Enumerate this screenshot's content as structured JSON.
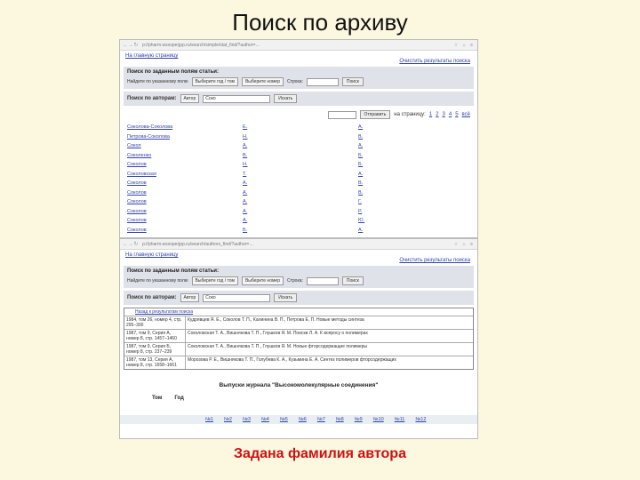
{
  "slide": {
    "title": "Поиск по архиву",
    "caption": "Задана фамилия автора"
  },
  "browser": {
    "url1": "p://pharm.wsxoperjpp.ru/search/simple/stat_find/?author=…",
    "url2": "p://pharm.wsxoperjpp.ru/search/authors_find/?author=…"
  },
  "shot1": {
    "top_link": "На главную страницу",
    "clear_link": "Очистить результаты поиска",
    "search_box": {
      "header": "Поиск по заданным полям статьи:",
      "field_label": "Найдите по указанному полю",
      "select1": "Выберите год / том",
      "select2": "Выберите номер",
      "phrase_label": "Строка:",
      "button": "Поиск"
    },
    "author_box": {
      "label": "Поиск по авторам:",
      "select": "Автор",
      "value": "Соко",
      "button": "Искать"
    },
    "pager": {
      "button": "Отправить",
      "label": "на страницу:",
      "pages": [
        "1",
        "2",
        "3",
        "4",
        "5",
        "всё"
      ]
    },
    "authors": [
      {
        "surname": "Соколова-Соколова",
        "i1": "Е.",
        "i2": "А."
      },
      {
        "surname": "Петрова-Соколова",
        "i1": "Н.",
        "i2": "В."
      },
      {
        "surname": "Сокол",
        "i1": "А.",
        "i2": "А."
      },
      {
        "surname": "Соколенко",
        "i1": "В.",
        "i2": "Б."
      },
      {
        "surname": "Соколов",
        "i1": "Н.",
        "i2": "Б."
      },
      {
        "surname": "Соколовская",
        "i1": "Т.",
        "i2": "А."
      },
      {
        "surname": "Соколов",
        "i1": "А.",
        "i2": "В."
      },
      {
        "surname": "Соколов",
        "i1": "А.",
        "i2": "В."
      },
      {
        "surname": "Соколов",
        "i1": "А.",
        "i2": "Г."
      },
      {
        "surname": "Соколов",
        "i1": "А.",
        "i2": "Р."
      },
      {
        "surname": "Соколов",
        "i1": "А.",
        "i2": "Ю."
      },
      {
        "surname": "Соколов",
        "i1": "Б.",
        "i2": "А."
      }
    ]
  },
  "shot2": {
    "top_link": "На главную страницу",
    "clear_link": "Очистить результаты поиска",
    "search_box": {
      "header": "Поиск по заданным полям статьи:",
      "field_label": "Найдите по указанному полю",
      "select1": "Выберите год / том",
      "select2": "Выберите номер",
      "phrase_label": "Строка:",
      "button": "Поиск"
    },
    "author_box": {
      "label": "Поиск по авторам:",
      "select": "Автор",
      "value": "Соко",
      "button": "Искать"
    },
    "results_header": "Назад к результатам поиска",
    "results": [
      {
        "source": "1984, том 26, номер 4, стр. 295–300",
        "title": "Кудрявцев Я. Е., Соколов Т. П., Калинина В. П., Петрова Е. П. Новые методы синтеза"
      },
      {
        "source": "1987, том 9, Серия А, номер 8, стр. 1457–1460",
        "title": "Соколовская Т. А., Вишнякова Т. П., Глушков Я. М. Поиски Л. А. К вопросу о полимерах"
      },
      {
        "source": "1987, том 9, Серия Б, номер 8, стр. 237–239",
        "title": "Соколовская Т. А., Вишнякова Т. П., Глушков Я. М. Новые фторсодержащие полимеры"
      },
      {
        "source": "1987, том 13, Серия А, номер 8, стр. 1658–1661",
        "title": "Морозова Р. Е., Вишнякова Т. П., Голубева К. А., Кузьмина Е. А. Синтез полимеров фторсодержащих"
      }
    ],
    "issues_title": "Выпуски журнала \"Высокомолекулярные соединения\"",
    "col_tom": "Том",
    "col_year": "Год",
    "issue_numbers": [
      "№1",
      "№2",
      "№3",
      "№4",
      "№5",
      "№6",
      "№7",
      "№8",
      "№9",
      "№10",
      "№11",
      "№12"
    ]
  }
}
